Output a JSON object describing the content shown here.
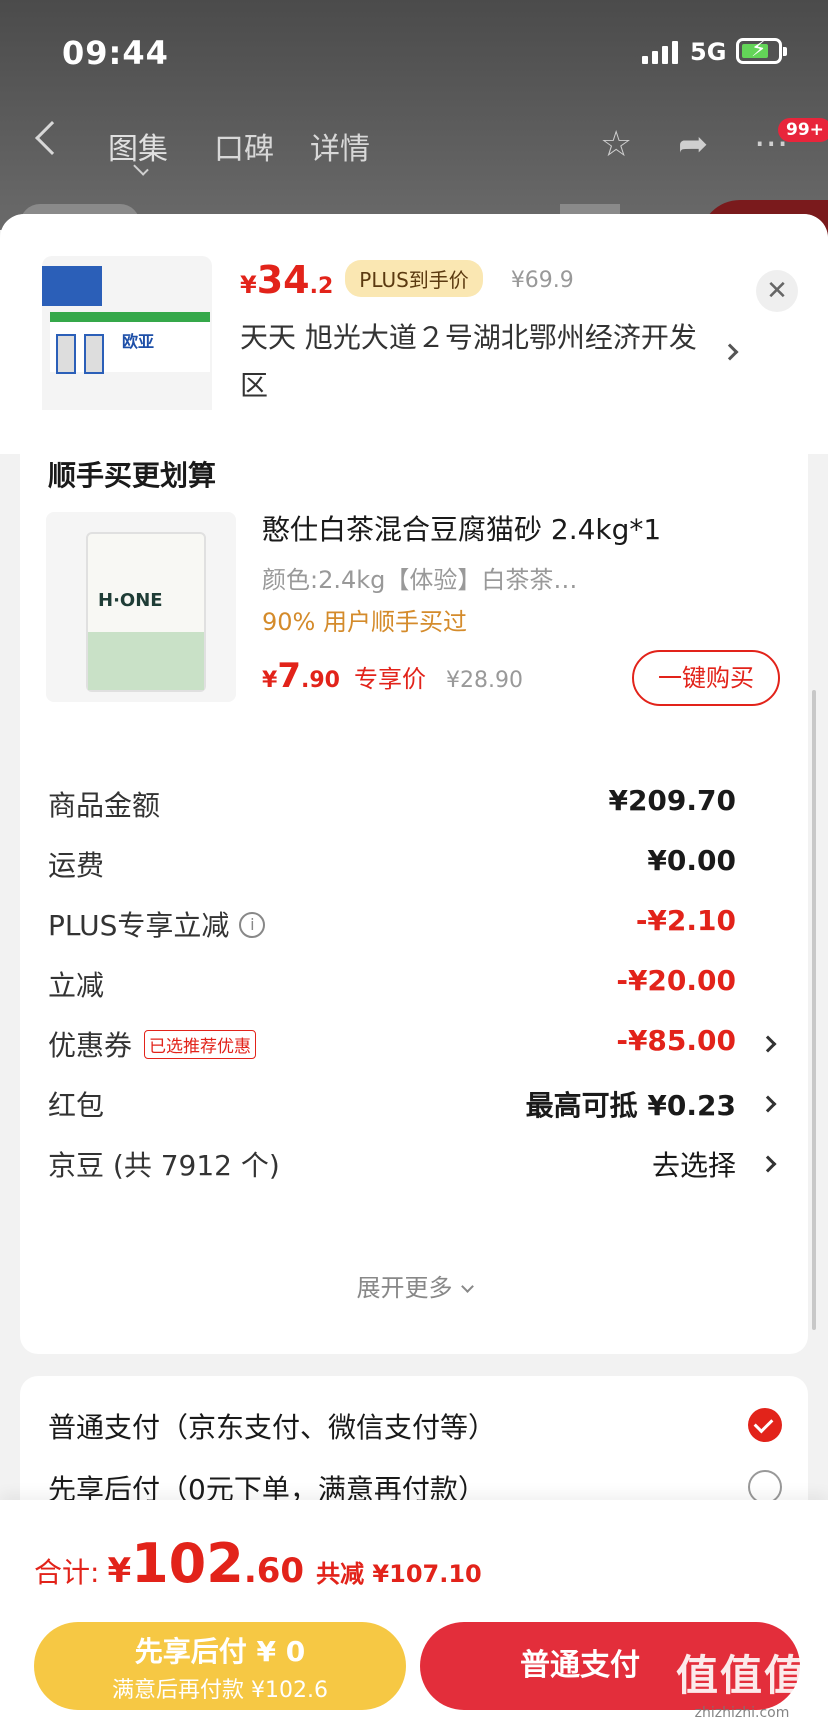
{
  "status_bar": {
    "time": "09:44",
    "network": "5G"
  },
  "nav": {
    "tabs": [
      {
        "label": "图集"
      },
      {
        "label": "口碑"
      },
      {
        "label": "详情"
      }
    ],
    "badge": "99+"
  },
  "header": {
    "price_currency": "¥",
    "price_int": "34",
    "price_dec": ".2",
    "plus_tag": "PLUS到手价",
    "original_price": "¥69.9",
    "address": "天天  旭光大道２号湖北鄂州经济开发区",
    "close": "✕",
    "product_brand": "欧亚"
  },
  "addon": {
    "title": "顺手买更划算",
    "name": "憨仕白茶混合豆腐猫砂 2.4kg*1",
    "spec": "颜色:2.4kg【体验】白茶茶…",
    "hot": "90% 用户顺手买过",
    "price_currency": "¥",
    "price_int": "7",
    "price_dec": ".90",
    "price_tag": "专享价",
    "original_price": "¥28.90",
    "buy_button": "一键购买",
    "bag_name": "H·ONE"
  },
  "summary": {
    "rows": [
      {
        "label": "商品金额",
        "value": "¥209.70"
      },
      {
        "label": "运费",
        "value": "¥0.00"
      },
      {
        "label": "PLUS专享立减",
        "value": "-¥2.10"
      },
      {
        "label": "立减",
        "value": "-¥20.00"
      },
      {
        "label": "优惠券",
        "tag": "已选推荐优惠",
        "value": "-¥85.00"
      },
      {
        "label": "红包",
        "value": "最高可抵 ¥0.23"
      },
      {
        "label": "京豆 (共 7912 个)",
        "value": "去选择"
      }
    ],
    "expand": "展开更多"
  },
  "payment": {
    "options": [
      {
        "label": "普通支付（京东支付、微信支付等）",
        "selected": true
      },
      {
        "label": "先享后付（0元下单，满意再付款）",
        "selected": false
      }
    ]
  },
  "bottom": {
    "total_label": "合计:",
    "total_currency": "¥",
    "total_int": "102",
    "total_dec": ".60",
    "total_save": "共减 ¥107.10",
    "later_line1": "先享后付 ¥ 0",
    "later_line2": "满意后再付款 ¥102.6",
    "normal_button": "普通支付",
    "watermark": "值值值",
    "watermark_sub": "zhizhizhi.com"
  },
  "colors": {
    "accent": "#e2231a",
    "plus": "#fae7b2",
    "later_button": "#f6c844"
  }
}
